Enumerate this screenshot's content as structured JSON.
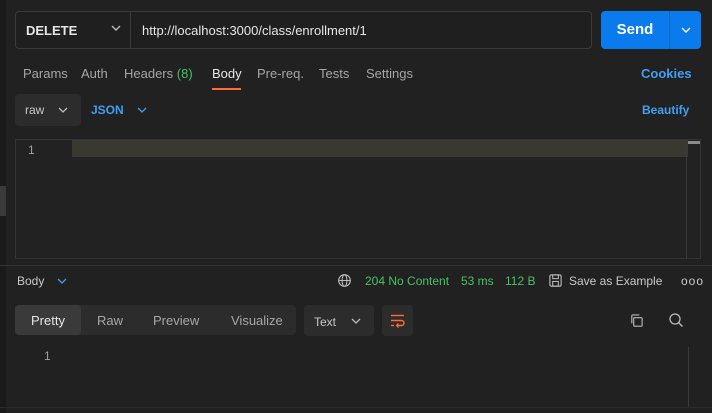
{
  "request": {
    "method": "DELETE",
    "url": "http://localhost:3000/class/enrollment/1",
    "send_label": "Send"
  },
  "request_tabs": [
    {
      "label": "Params"
    },
    {
      "label": "Auth"
    },
    {
      "label": "Headers",
      "count": "(8)"
    },
    {
      "label": "Body",
      "active": true
    },
    {
      "label": "Pre-req."
    },
    {
      "label": "Tests"
    },
    {
      "label": "Settings"
    }
  ],
  "cookies_label": "Cookies",
  "body": {
    "mode": "raw",
    "language": "JSON",
    "beautify_label": "Beautify",
    "line_numbers": [
      "1"
    ]
  },
  "response": {
    "section_label": "Body",
    "status": "204 No Content",
    "time": "53 ms",
    "size": "112 B",
    "save_label": "Save as Example",
    "more_label": "ooo",
    "view_tabs": [
      {
        "label": "Pretty",
        "active": true
      },
      {
        "label": "Raw"
      },
      {
        "label": "Preview"
      },
      {
        "label": "Visualize"
      }
    ],
    "format": "Text",
    "line_numbers": [
      "1"
    ]
  },
  "colors": {
    "accent_orange": "#ff6c37",
    "send_blue": "#097bed",
    "link_blue": "#3f9ff5",
    "status_green": "#47c265"
  },
  "icons": [
    "chevron-down-icon",
    "globe-icon",
    "save-icon",
    "wrap-lines-icon",
    "copy-icon",
    "search-icon"
  ]
}
